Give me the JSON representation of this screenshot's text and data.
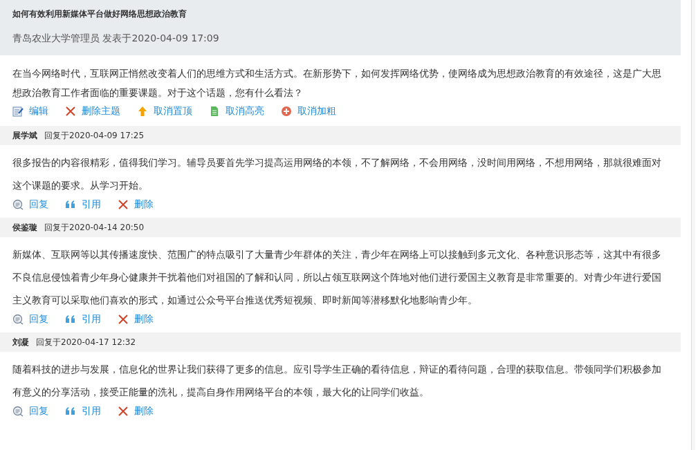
{
  "topic": {
    "title": "如何有效利用新媒体平台做好网络思想政治教育",
    "meta": "青岛农业大学管理员 发表于2020-04-09 17:09",
    "body": "在当今网络时代，互联网正悄然改变着人们的思维方式和生活方式。在新形势下，如何发挥网络优势，使网络成为思想政治教育的有效途径，这是广大思想政治教育工作者面临的重要课题。对于这个话题，您有什么看法？",
    "actions": [
      {
        "kind": "edit",
        "label": "编辑"
      },
      {
        "kind": "delete",
        "label": "删除主题"
      },
      {
        "kind": "top",
        "label": "取消置顶"
      },
      {
        "kind": "highlight",
        "label": "取消高亮"
      },
      {
        "kind": "bold",
        "label": "取消加粗"
      }
    ]
  },
  "replies": [
    {
      "author": "展学斌",
      "time": "回复于2020-04-09 17:25",
      "body": "很多报告的内容很精彩，值得我们学习。辅导员要首先学习提高运用网络的本领，不了解网络，不会用网络，没时间用网络，不想用网络，那就很难面对这个课题的要求。从学习开始。",
      "actions": [
        {
          "kind": "reply",
          "label": "回复"
        },
        {
          "kind": "quote",
          "label": "引用"
        },
        {
          "kind": "delete",
          "label": "删除"
        }
      ]
    },
    {
      "author": "侯鉴璇",
      "time": "回复于2020-04-14 20:50",
      "body": "新媒体、互联网等以其传播速度快、范围广的特点吸引了大量青少年群体的关注，青少年在网络上可以接触到多元文化、各种意识形态等，这其中有很多不良信息侵蚀着青少年身心健康并干扰着他们对祖国的了解和认同，所以占领互联网这个阵地对他们进行爱国主义教育是非常重要的。对青少年进行爱国主义教育可以采取他们喜欢的形式，如通过公众号平台推送优秀短视频、即时新闻等潜移默化地影响青少年。",
      "actions": [
        {
          "kind": "reply",
          "label": "回复"
        },
        {
          "kind": "quote",
          "label": "引用"
        },
        {
          "kind": "delete",
          "label": "删除"
        }
      ]
    },
    {
      "author": "刘凝",
      "time": "回复于2020-04-17 12:32",
      "body": "随着科技的进步与发展，信息化的世界让我们获得了更多的信息。应引导学生正确的看待信息，辩证的看待问题，合理的获取信息。带领同学们积极参加有意义的分享活动，接受正能量的洗礼，提高自身作用网络平台的本领，最大化的让同学们收益。",
      "actions": [
        {
          "kind": "reply",
          "label": "回复"
        },
        {
          "kind": "quote",
          "label": "引用"
        },
        {
          "kind": "delete",
          "label": "删除"
        }
      ]
    }
  ]
}
